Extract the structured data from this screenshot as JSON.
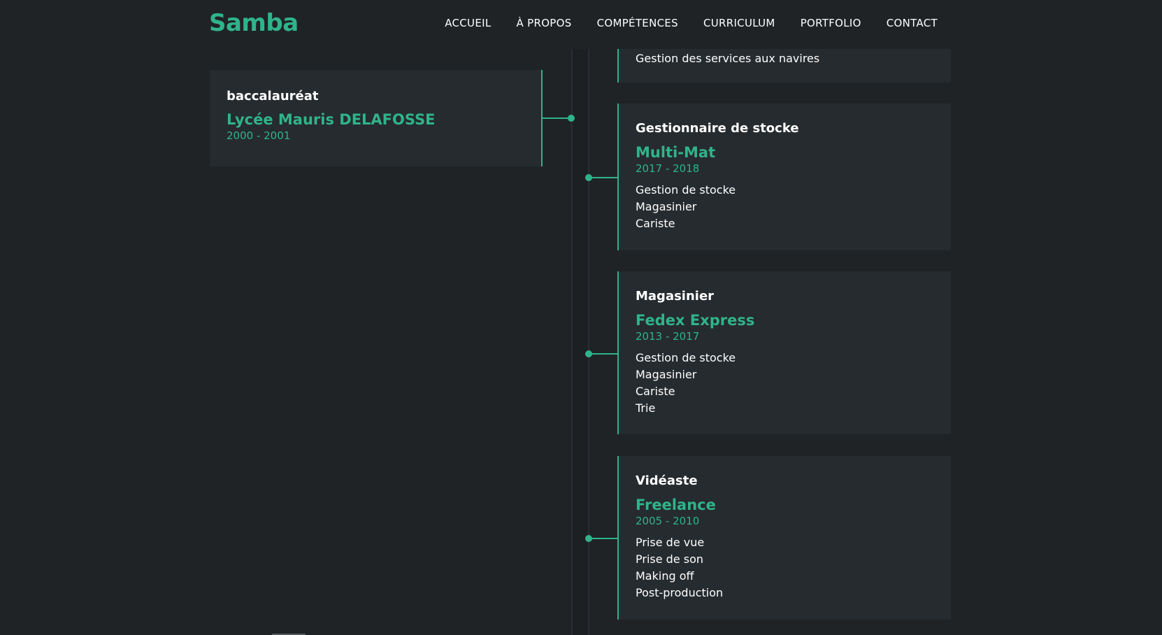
{
  "header": {
    "logo": "Samba",
    "nav": [
      "ACCUEIL",
      "À PROPOS",
      "COMPÉTENCES",
      "CURRICULUM",
      "PORTFOLIO",
      "CONTACT"
    ]
  },
  "education": [
    {
      "title": "baccalauréat",
      "org": "Lycée Mauris DELAFOSSE",
      "dates": "2000 - 2001"
    }
  ],
  "experience": [
    {
      "title": "",
      "org": "",
      "dates": "",
      "items": [
        "Gestion des services aux navires"
      ]
    },
    {
      "title": "Gestionnaire de stocke",
      "org": "Multi-Mat",
      "dates": "2017 - 2018",
      "items": [
        "Gestion de stocke",
        "Magasinier",
        "Cariste"
      ]
    },
    {
      "title": "Magasinier",
      "org": "Fedex Express",
      "dates": "2013 - 2017",
      "items": [
        "Gestion de stocke",
        "Magasinier",
        "Cariste",
        "Trie"
      ]
    },
    {
      "title": "Vidéaste",
      "org": "Freelance",
      "dates": "2005 - 2010",
      "items": [
        "Prise de vue",
        "Prise de son",
        "Making off",
        "Post-production"
      ]
    }
  ],
  "colors": {
    "accent": "#2fb489",
    "background": "#1f2326",
    "card": "#262b2f"
  }
}
